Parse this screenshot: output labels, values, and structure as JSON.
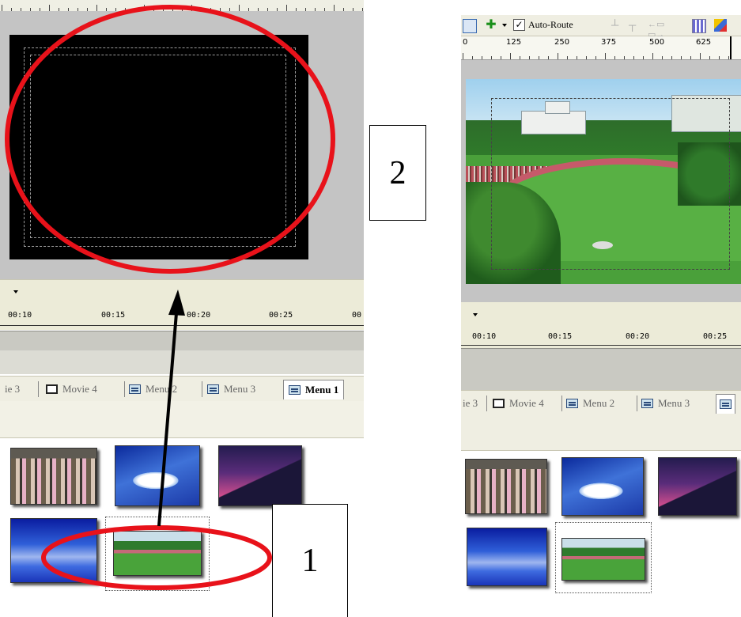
{
  "left_panel": {
    "timeline_ticks": [
      "00:10",
      "00:15",
      "00:20",
      "00:25",
      "00"
    ],
    "tabs": [
      {
        "label": "ie 3",
        "icon": "none"
      },
      {
        "label": "Movie 4",
        "icon": "film-icon"
      },
      {
        "label": "Menu 2",
        "icon": "menu-icon"
      },
      {
        "label": "Menu 3",
        "icon": "menu-icon"
      },
      {
        "label": "Menu 1",
        "icon": "menu-icon",
        "active": true
      }
    ],
    "thumbnails": [
      "group-photo",
      "pool",
      "sunset",
      "water",
      "stadium-field"
    ]
  },
  "right_panel": {
    "toolbar": {
      "auto_route_label": "Auto-Route",
      "auto_route_checked": true
    },
    "ruler_ticks": [
      "0",
      "125",
      "250",
      "375",
      "500",
      "625"
    ],
    "timeline_ticks": [
      "00:10",
      "00:15",
      "00:20",
      "00:25"
    ],
    "tabs": [
      {
        "label": "ie 3",
        "icon": "none"
      },
      {
        "label": "Movie 4",
        "icon": "film-icon"
      },
      {
        "label": "Menu 2",
        "icon": "menu-icon"
      },
      {
        "label": "Menu 3",
        "icon": "menu-icon"
      }
    ],
    "thumbnails": [
      "group-photo",
      "pool",
      "sunset",
      "water",
      "stadium-field"
    ]
  },
  "annotations": {
    "step_1": "1",
    "step_2": "2",
    "highlight_color": "#e8121a",
    "arrow_color": "#000000"
  }
}
